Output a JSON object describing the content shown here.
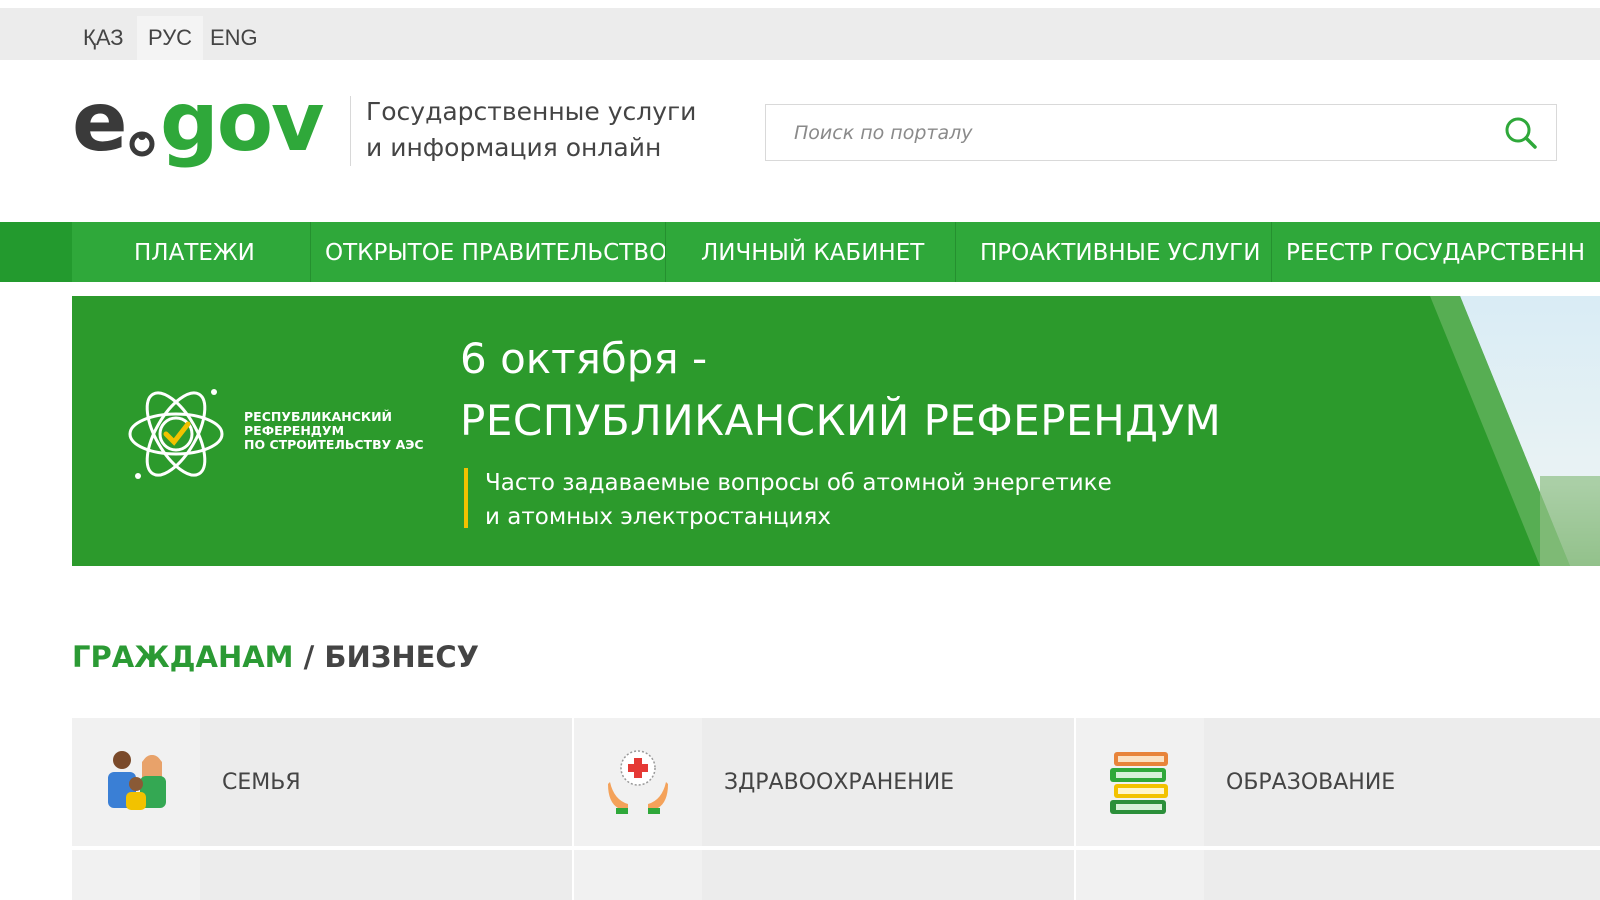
{
  "languages": [
    {
      "label": "ҚАЗ",
      "active": false
    },
    {
      "label": "РУС",
      "active": true
    },
    {
      "label": "ENG",
      "active": false
    }
  ],
  "header": {
    "logo_text": "egov",
    "tagline_line1": "Государственные услуги",
    "tagline_line2": "и информация онлайн"
  },
  "search": {
    "placeholder": "Поиск по порталу",
    "value": ""
  },
  "nav": {
    "items": [
      "ПЛАТЕЖИ",
      "ОТКРЫТОЕ ПРАВИТЕЛЬСТВО",
      "ЛИЧНЫЙ КАБИНЕТ",
      "ПРОАКТИВНЫЕ УСЛУГИ",
      "РЕЕСТР ГОСУДАРСТВЕНН"
    ]
  },
  "banner": {
    "logo_caption_1": "РЕСПУБЛИКАНСКИЙ",
    "logo_caption_2": "РЕФЕРЕНДУМ",
    "logo_caption_3": "ПО СТРОИТЕЛЬСТВУ АЭС",
    "date": "6 октября -",
    "title": "РЕСПУБЛИКАНСКИЙ РЕФЕРЕНДУМ",
    "subtitle_line1": "Часто задаваемые вопросы об атомной энергетике",
    "subtitle_line2": "и атомных электростанциях"
  },
  "section": {
    "citizens": "ГРАЖДАНАМ",
    "separator": "/",
    "business": "БИЗНЕСУ"
  },
  "categories": [
    {
      "label": "СЕМЬЯ",
      "icon": "family-icon"
    },
    {
      "label": "ЗДРАВООХРАНЕНИЕ",
      "icon": "healthcare-icon"
    },
    {
      "label": "ОБРАЗОВАНИЕ",
      "icon": "books-icon"
    }
  ],
  "colors": {
    "brand_green": "#2fa83a",
    "banner_green": "#2c9a2c",
    "accent_yellow": "#f2c200",
    "tile_bg": "#ececec"
  }
}
